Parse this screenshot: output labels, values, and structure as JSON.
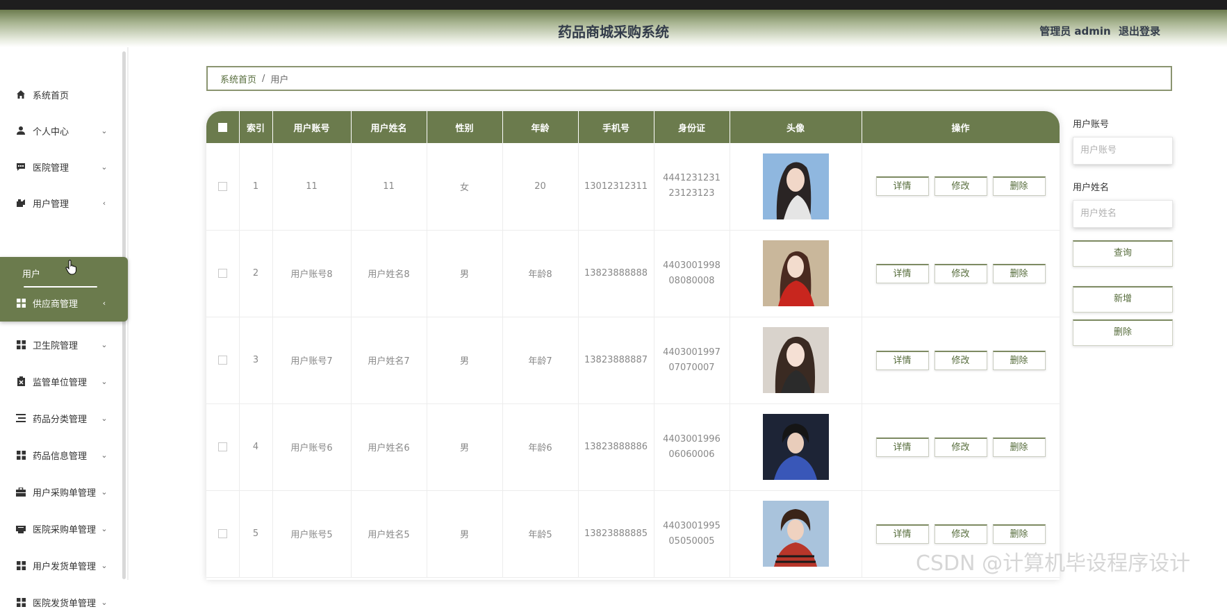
{
  "header": {
    "title": "药品商城采购系统",
    "role": "管理员 admin",
    "logout": "退出登录"
  },
  "sidebar": {
    "items": [
      {
        "label": "系统首页",
        "icon": "home-icon"
      },
      {
        "label": "个人中心",
        "icon": "person-icon"
      },
      {
        "label": "医院管理",
        "icon": "chat-icon"
      },
      {
        "label": "用户管理",
        "icon": "user-manage-icon"
      },
      {
        "label": "卫生院管理",
        "icon": "grid-icon"
      },
      {
        "label": "监管单位管理",
        "icon": "clipboard-x-icon"
      },
      {
        "label": "药品分类管理",
        "icon": "list-icon"
      },
      {
        "label": "药品信息管理",
        "icon": "grid-icon"
      },
      {
        "label": "用户采购单管理",
        "icon": "briefcase-icon"
      },
      {
        "label": "医院采购单管理",
        "icon": "printer-icon"
      },
      {
        "label": "用户发货单管理",
        "icon": "grid-icon"
      },
      {
        "label": "医院发货单管理",
        "icon": "grid-icon"
      }
    ],
    "active_sub": "用户",
    "active_item": "供应商管理"
  },
  "breadcrumb": {
    "home": "系统首页",
    "separator": "/",
    "current": "用户"
  },
  "table": {
    "columns": [
      "索引",
      "用户账号",
      "用户姓名",
      "性别",
      "年龄",
      "手机号",
      "身份证",
      "头像",
      "操作"
    ],
    "actions": [
      "详情",
      "修改",
      "删除"
    ],
    "rows": [
      {
        "index": "1",
        "account": "11",
        "name": "11",
        "gender": "女",
        "age": "20",
        "phone": "13012312311",
        "idcard": "444123123123123123"
      },
      {
        "index": "2",
        "account": "用户账号8",
        "name": "用户姓名8",
        "gender": "男",
        "age": "年龄8",
        "phone": "13823888888",
        "idcard": "440300199808080008"
      },
      {
        "index": "3",
        "account": "用户账号7",
        "name": "用户姓名7",
        "gender": "男",
        "age": "年龄7",
        "phone": "13823888887",
        "idcard": "440300199707070007"
      },
      {
        "index": "4",
        "account": "用户账号6",
        "name": "用户姓名6",
        "gender": "男",
        "age": "年龄6",
        "phone": "13823888886",
        "idcard": "440300199606060006"
      },
      {
        "index": "5",
        "account": "用户账号5",
        "name": "用户姓名5",
        "gender": "男",
        "age": "年龄5",
        "phone": "13823888885",
        "idcard": "440300199505050005"
      }
    ]
  },
  "search": {
    "account_label": "用户账号",
    "account_placeholder": "用户账号",
    "name_label": "用户姓名",
    "name_placeholder": "用户姓名",
    "query": "查询",
    "add": "新增",
    "delete": "删除"
  },
  "watermark": "CSDN @计算机毕设程序设计",
  "colors": {
    "accent": "#6b7b4d",
    "header_top": "#6d7d4f"
  }
}
